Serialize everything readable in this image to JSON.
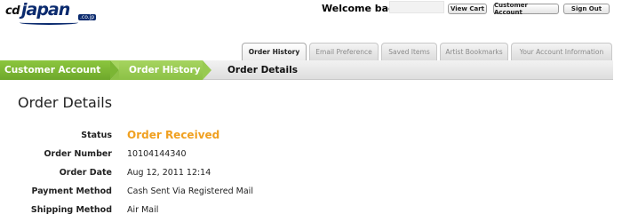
{
  "header": {
    "logo": {
      "cd": "cd",
      "japan": "japan",
      "domain": ".co.jp"
    },
    "welcome_text": "Welcome back,",
    "username": "",
    "buttons": {
      "view_cart": "View Cart",
      "customer_account": "Customer Account",
      "sign_out": "Sign Out"
    }
  },
  "tabs": [
    {
      "label": "Order History",
      "active": true
    },
    {
      "label": "Email Preference",
      "active": false
    },
    {
      "label": "Saved Items",
      "active": false
    },
    {
      "label": "Artist Bookmarks",
      "active": false
    },
    {
      "label": "Your Account Information",
      "active": false
    }
  ],
  "breadcrumb": [
    {
      "label": "Customer Account"
    },
    {
      "label": "Order History"
    },
    {
      "label": "Order Details"
    }
  ],
  "page": {
    "title": "Order Details"
  },
  "details": [
    {
      "label": "Status",
      "value": "Order Received"
    },
    {
      "label": "Order Number",
      "value": "10104144340"
    },
    {
      "label": "Order Date",
      "value": "Aug 12, 2011 12:14"
    },
    {
      "label": "Payment Method",
      "value": "Cash Sent Via Registered Mail"
    },
    {
      "label": "Shipping Method",
      "value": "Air Mail"
    }
  ],
  "colors": {
    "brand_navy": "#0a2a6e",
    "breadcrumb_green": "#7bb634",
    "status_orange": "#f0a020"
  }
}
